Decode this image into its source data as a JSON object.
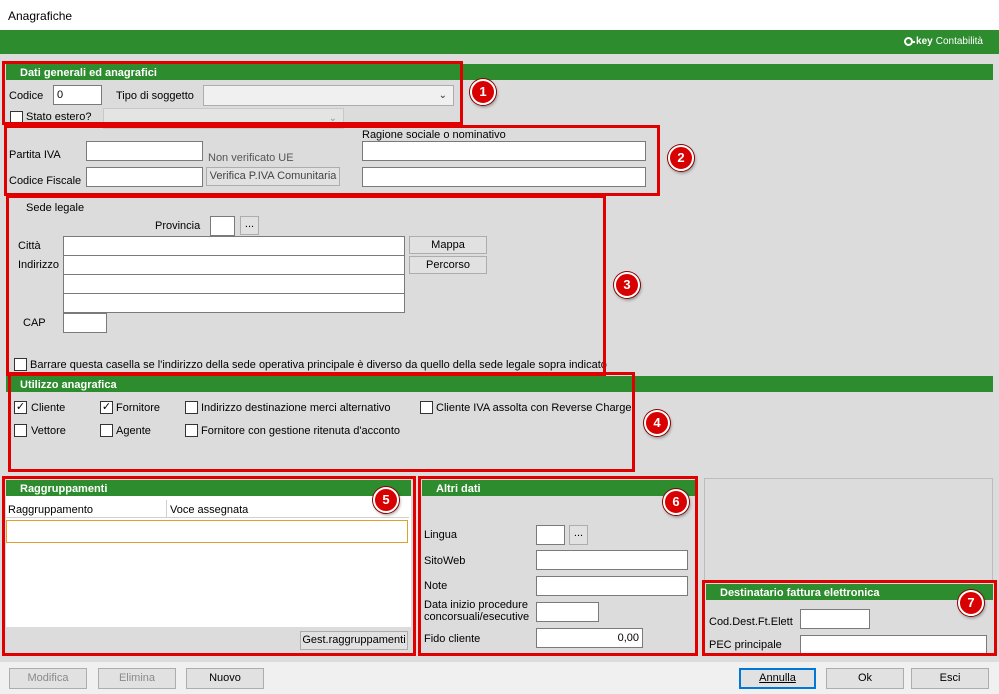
{
  "window": {
    "title": "Anagrafiche"
  },
  "brand": {
    "prefix": "key",
    "name": "Contabilità"
  },
  "section1": {
    "header": "Dati generali ed anagrafici",
    "codice_label": "Codice",
    "codice_value": "0",
    "tipo_label": "Tipo di soggetto",
    "tipo_value": "",
    "stato_estero_label": "Stato estero?",
    "badge": "1"
  },
  "section2": {
    "partita_iva_label": "Partita IVA",
    "codice_fiscale_label": "Codice Fiscale",
    "non_verificato": "Non verificato UE",
    "verifica_button": "Verifica P.IVA Comunitaria",
    "ragione_label": "Ragione sociale o nominativo",
    "badge": "2"
  },
  "section3": {
    "sede_label": "Sede legale",
    "provincia_label": "Provincia",
    "browse_label": "...",
    "citta_label": "Città",
    "indirizzo_label": "Indirizzo",
    "cap_label": "CAP",
    "mappa_button": "Mappa",
    "percorso_button": "Percorso",
    "checkbox_label": "Barrare questa casella se l'indirizzo della sede operativa principale è diverso da quello della sede legale sopra indicato",
    "badge": "3"
  },
  "section4": {
    "header": "Utilizzo anagrafica",
    "options": [
      {
        "label": "Cliente",
        "checked": true
      },
      {
        "label": "Fornitore",
        "checked": true
      },
      {
        "label": "Indirizzo destinazione merci alternativo",
        "checked": false
      },
      {
        "label": "Cliente IVA assolta con Reverse Charge",
        "checked": false
      },
      {
        "label": "Vettore",
        "checked": false
      },
      {
        "label": "Agente",
        "checked": false
      },
      {
        "label": "Fornitore con gestione ritenuta d'acconto",
        "checked": false
      }
    ],
    "check_mark": "✓",
    "badge": "4"
  },
  "section5": {
    "header": "Raggruppamenti",
    "columns": [
      "Raggruppamento",
      "Voce assegnata"
    ],
    "button": "Gest.raggruppamenti",
    "badge": "5"
  },
  "section6": {
    "header": "Altri dati",
    "lingua_label": "Lingua",
    "browse_label": "...",
    "sitoweb_label": "SitoWeb",
    "note_label": "Note",
    "data_inizio_label_1": "Data inizio procedure",
    "data_inizio_label_2": "concorsuali/esecutive",
    "fido_label": "Fido cliente",
    "fido_value": "0,00",
    "badge": "6"
  },
  "section7": {
    "header": "Destinatario fattura elettronica",
    "cod_dest_label": "Cod.Dest.Ft.Elett",
    "pec_label": "PEC principale",
    "badge": "7"
  },
  "footer": {
    "modifica": "Modifica",
    "elimina": "Elimina",
    "nuovo": "Nuovo",
    "annulla": "Annulla",
    "ok": "Ok",
    "esci": "Esci"
  },
  "colors": {
    "brand_green": "#2c8c2e",
    "highlight_red": "#e00000"
  }
}
